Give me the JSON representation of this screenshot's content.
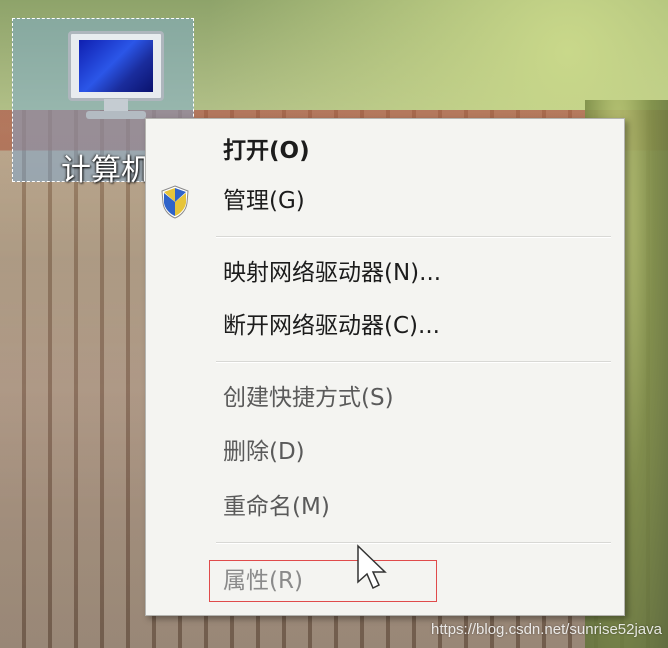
{
  "desktop_icon": {
    "label": "计算机"
  },
  "context_menu": {
    "items": [
      {
        "label": "打开(O)"
      },
      {
        "label": "管理(G)"
      },
      {
        "label": "映射网络驱动器(N)..."
      },
      {
        "label": "断开网络驱动器(C)..."
      },
      {
        "label": "创建快捷方式(S)"
      },
      {
        "label": "删除(D)"
      },
      {
        "label": "重命名(M)"
      },
      {
        "label": "属性(R)"
      }
    ]
  },
  "watermark": {
    "text": "https://blog.csdn.net/sunrise52java"
  },
  "colors": {
    "menu_background": "#f4f4f1",
    "highlight_border": "#e04b4b",
    "selection_blue": "#78aadc"
  }
}
